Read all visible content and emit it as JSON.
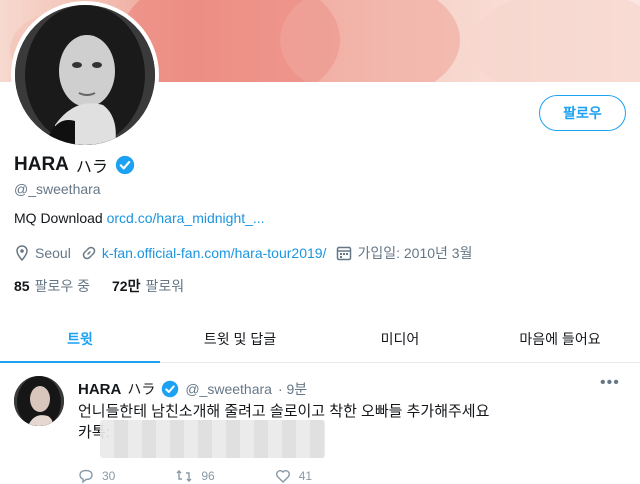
{
  "profile": {
    "name": "HARA",
    "name_kana": "ハラ",
    "handle": "@_sweethara",
    "bio_text": "MQ Download",
    "bio_link": "orcd.co/hara_midnight_...",
    "location": "Seoul",
    "website": "k-fan.official-fan.com/hara-tour2019/",
    "joined": "가입일: 2010년 3월",
    "following_count": "85",
    "following_label": "팔로우 중",
    "followers_count": "72만",
    "followers_label": "팔로워"
  },
  "header": {
    "follow_label": "팔로우"
  },
  "tabs": [
    {
      "label": "트윗"
    },
    {
      "label": "트윗 및 답글"
    },
    {
      "label": "미디어"
    },
    {
      "label": "마음에 들어요"
    }
  ],
  "tweet": {
    "name": "HARA",
    "name_kana": "ハラ",
    "handle": "@_sweethara",
    "time": "· 9분",
    "line1": "언니들한테 남친소개해 줄려고 솔로이고 착한 오빠들 추가해주세요",
    "line2": "카톡:",
    "reply_count": "30",
    "retweet_count": "96",
    "like_count": "41"
  },
  "colors": {
    "accent": "#1da1f2",
    "muted": "#657786",
    "link": "#1b95e0"
  },
  "icons": [
    "verified-badge-icon",
    "location-pin-icon",
    "link-icon",
    "calendar-icon",
    "more-icon",
    "reply-icon",
    "retweet-icon",
    "like-icon"
  ]
}
